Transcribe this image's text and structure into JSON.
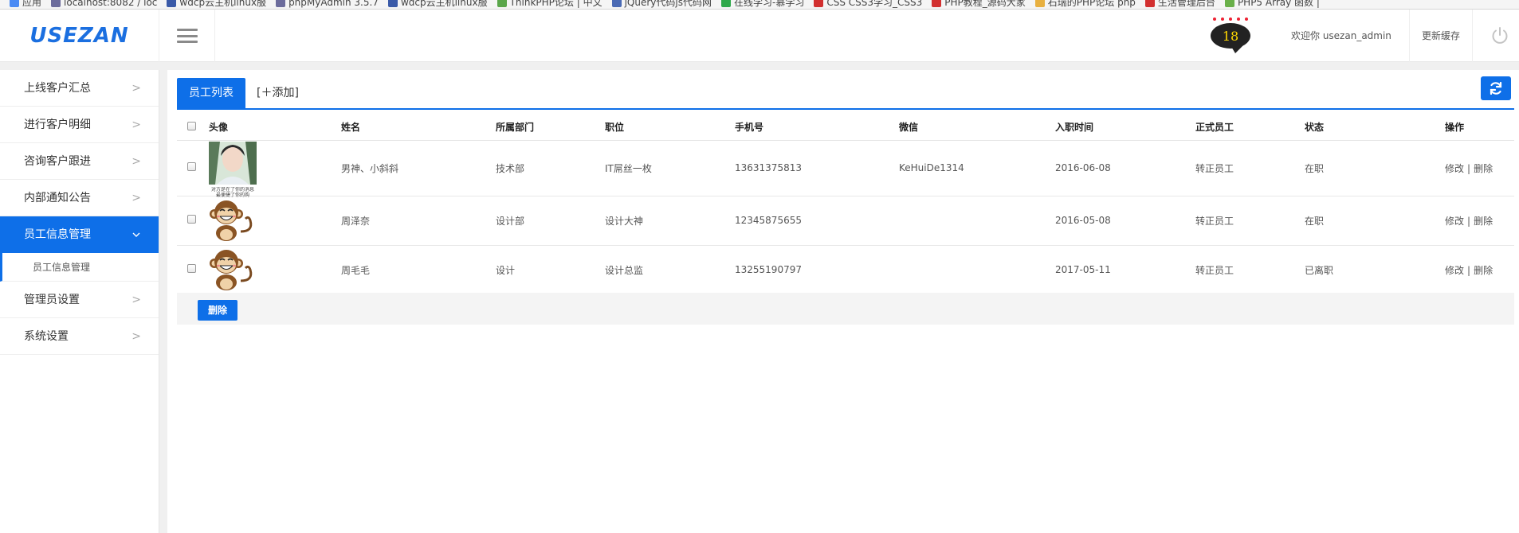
{
  "browser": {
    "bookmarks": [
      {
        "label": "应用",
        "color": "#4a8af4"
      },
      {
        "label": "localhost:8082 / loc",
        "color": "#6c6c9c"
      },
      {
        "label": "wdcp云主机linux服",
        "color": "#3a5aa8"
      },
      {
        "label": "phpMyAdmin 3.5.7",
        "color": "#6c6c9c"
      },
      {
        "label": "wdcp云主机linux服",
        "color": "#3a5aa8"
      },
      {
        "label": "ThinkPHP论坛 | 中文",
        "color": "#5aa64a"
      },
      {
        "label": "jQuery代码js代码网",
        "color": "#4a6ab4"
      },
      {
        "label": "在线学习-慕学习",
        "color": "#2ea84a"
      },
      {
        "label": "CSS CSS3学习_CSS3",
        "color": "#d23030"
      },
      {
        "label": "PHP教程_源码大家",
        "color": "#d23030"
      },
      {
        "label": "石瑞的PHP论坛 php",
        "color": "#e8b040"
      },
      {
        "label": "生活管理后台",
        "color": "#d23030"
      },
      {
        "label": "PHP5 Array 函数 |",
        "color": "#6ab04a"
      }
    ]
  },
  "header": {
    "logo": "USEZAN",
    "notification_count": "18",
    "welcome": "欢迎你 usezan_admin",
    "refresh_cache": "更新缓存"
  },
  "sidebar": {
    "items": [
      {
        "label": "上线客户汇总"
      },
      {
        "label": "进行客户明细"
      },
      {
        "label": "咨询客户跟进"
      },
      {
        "label": "内部通知公告"
      },
      {
        "label": "员工信息管理"
      },
      {
        "label": "管理员设置"
      },
      {
        "label": "系统设置"
      }
    ],
    "sub_item": "员工信息管理"
  },
  "tabs": {
    "active": "员工列表",
    "add": "[＋添加]"
  },
  "table": {
    "headers": [
      "头像",
      "姓名",
      "所属部门",
      "职位",
      "手机号",
      "微信",
      "入职时间",
      "正式员工",
      "状态",
      "操作"
    ],
    "rows": [
      {
        "name": "男神、小斜斜",
        "dept": "技术部",
        "position": "IT屌丝一枚",
        "phone": "13631375813",
        "wechat": "KeHuiDe1314",
        "join_date": "2016-06-08",
        "regular": "转正员工",
        "status": "在职",
        "avatar": "photo",
        "avatar_caption_1": "对方是在了你的消息",
        "avatar_caption_2": "最便捷了你的购"
      },
      {
        "name": "周泽奈",
        "dept": "设计部",
        "position": "设计大神",
        "phone": "12345875655",
        "wechat": "",
        "join_date": "2016-05-08",
        "regular": "转正员工",
        "status": "在职",
        "avatar": "monkey"
      },
      {
        "name": "周毛毛",
        "dept": "设计",
        "position": "设计总监",
        "phone": "13255190797",
        "wechat": "",
        "join_date": "2017-05-11",
        "regular": "转正员工",
        "status": "已离职",
        "avatar": "monkey"
      }
    ],
    "edit_label": "修改",
    "delete_label": "删除",
    "separator": "|"
  },
  "footer": {
    "delete_button": "删除"
  }
}
